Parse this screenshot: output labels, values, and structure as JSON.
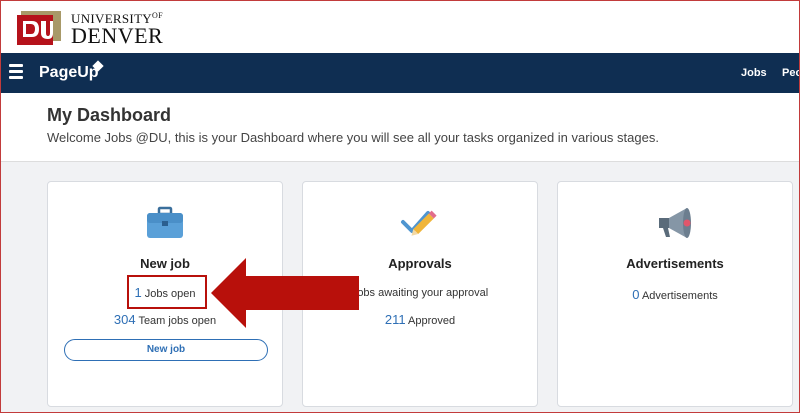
{
  "logo": {
    "university": "UNIVERSITY",
    "of": "OF",
    "name": "DENVER"
  },
  "nav": {
    "brand": "PageUp",
    "links": [
      "Jobs",
      "Peop"
    ]
  },
  "header": {
    "title": "My Dashboard",
    "welcome": "Welcome Jobs @DU, this is your Dashboard where you will see all your tasks organized in various stages."
  },
  "cards": {
    "new_job": {
      "title": "New job",
      "jobs_open_count": "1",
      "jobs_open_label": "Jobs open",
      "team_jobs_count": "304",
      "team_jobs_label": "Team jobs open",
      "button": "New job"
    },
    "approvals": {
      "title": "Approvals",
      "awaiting_label": "Jobs awaiting your approval",
      "approved_count": "211",
      "approved_label": "Approved"
    },
    "advertisements": {
      "title": "Advertisements",
      "count": "0",
      "label": "Advertisements"
    }
  },
  "icons": {
    "menu": "hamburger-icon",
    "new_job": "briefcase-icon",
    "approvals": "pencil-check-icon",
    "advertisements": "megaphone-icon"
  },
  "colors": {
    "nav_background": "#0f2e52",
    "accent_blue": "#2e6fb5",
    "annotation_red": "#b8100b",
    "du_red": "#b5121b",
    "du_gold": "#a89968"
  }
}
